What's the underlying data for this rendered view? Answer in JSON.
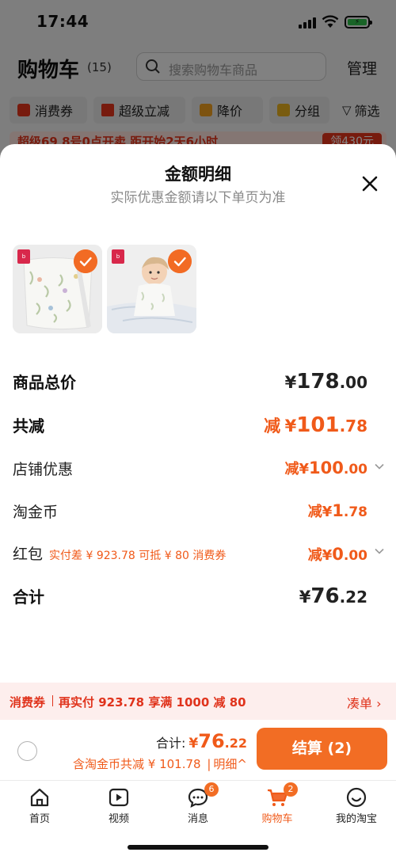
{
  "status_bar": {
    "time": "17:44"
  },
  "background": {
    "title": "购物车",
    "count": "(15)",
    "search_placeholder": "搜索购物车商品",
    "manage": "管理",
    "filters": [
      "消费券",
      "超级立减",
      "降价",
      "分组",
      "筛选"
    ],
    "banner_text": "超级69 8号0点开卖 距开始2天6小时",
    "banner_button": "领430元"
  },
  "sheet": {
    "title": "金额明细",
    "subtitle": "实际优惠金额请以下单页为准"
  },
  "breakdown": {
    "subtotal": {
      "label": "商品总价",
      "currency": "¥",
      "int": "178",
      "dec": ".00"
    },
    "total_discount": {
      "label": "共减",
      "prefix": "减",
      "currency": "¥",
      "int": "101",
      "dec": ".78"
    },
    "store_discount": {
      "label": "店铺优惠",
      "prefix": "减",
      "currency": "¥",
      "int": "100",
      "dec": ".00"
    },
    "taobao_coins": {
      "label": "淘金币",
      "prefix": "减",
      "currency": "¥",
      "int": "1",
      "dec": ".78"
    },
    "red_packet": {
      "label": "红包",
      "note": "实付差 ¥ 923.78 可抵 ¥ 80 消费券",
      "prefix": "减",
      "currency": "¥",
      "int": "0",
      "dec": ".00"
    },
    "total": {
      "label": "合计",
      "currency": "¥",
      "int": "76",
      "dec": ".22"
    }
  },
  "coupon_strip": {
    "tag": "消费券",
    "text": "再实付 923.78 享满 1000 减 80",
    "link": "凑单 ›"
  },
  "checkout": {
    "total_label": "合计:",
    "currency": "¥",
    "int": "76",
    "dec": ".22",
    "saved_text": "含淘金币共减 ¥ 101.78",
    "detail_label": "明细^",
    "pay_button": "结算 (2)"
  },
  "tabbar": {
    "tabs": [
      {
        "label": "首页",
        "icon": "home-icon"
      },
      {
        "label": "视频",
        "icon": "video-icon"
      },
      {
        "label": "消息",
        "icon": "message-icon",
        "badge": "6"
      },
      {
        "label": "购物车",
        "icon": "cart-icon",
        "badge": "2",
        "active": true
      },
      {
        "label": "我的淘宝",
        "icon": "profile-icon"
      }
    ]
  },
  "colors": {
    "accent": "#f05a1a",
    "button": "#f26d24",
    "coupon_bg": "#fdeeed"
  }
}
